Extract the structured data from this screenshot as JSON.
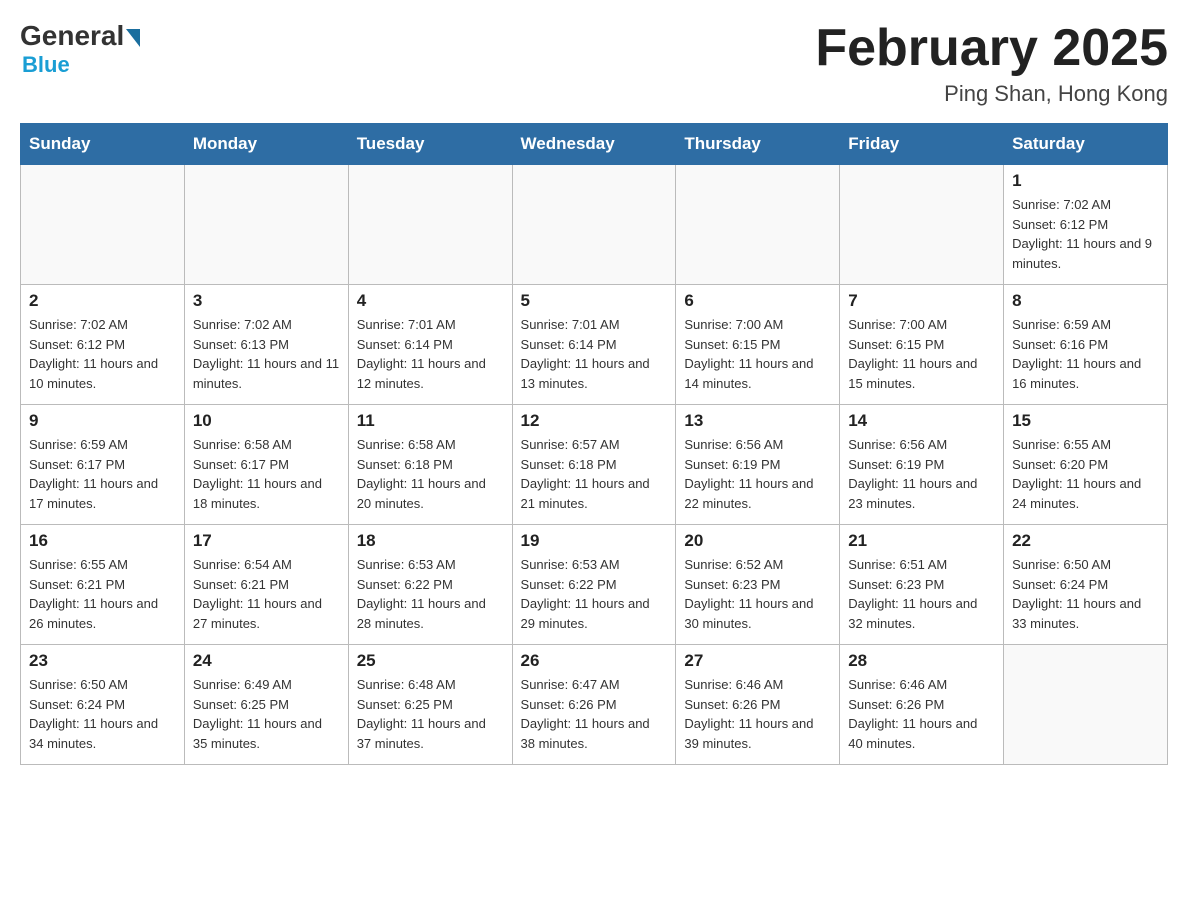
{
  "header": {
    "logo": {
      "general": "General",
      "blue": "Blue"
    },
    "title": "February 2025",
    "subtitle": "Ping Shan, Hong Kong"
  },
  "weekdays": [
    "Sunday",
    "Monday",
    "Tuesday",
    "Wednesday",
    "Thursday",
    "Friday",
    "Saturday"
  ],
  "weeks": [
    [
      {
        "day": "",
        "info": ""
      },
      {
        "day": "",
        "info": ""
      },
      {
        "day": "",
        "info": ""
      },
      {
        "day": "",
        "info": ""
      },
      {
        "day": "",
        "info": ""
      },
      {
        "day": "",
        "info": ""
      },
      {
        "day": "1",
        "info": "Sunrise: 7:02 AM\nSunset: 6:12 PM\nDaylight: 11 hours and 9 minutes."
      }
    ],
    [
      {
        "day": "2",
        "info": "Sunrise: 7:02 AM\nSunset: 6:12 PM\nDaylight: 11 hours and 10 minutes."
      },
      {
        "day": "3",
        "info": "Sunrise: 7:02 AM\nSunset: 6:13 PM\nDaylight: 11 hours and 11 minutes."
      },
      {
        "day": "4",
        "info": "Sunrise: 7:01 AM\nSunset: 6:14 PM\nDaylight: 11 hours and 12 minutes."
      },
      {
        "day": "5",
        "info": "Sunrise: 7:01 AM\nSunset: 6:14 PM\nDaylight: 11 hours and 13 minutes."
      },
      {
        "day": "6",
        "info": "Sunrise: 7:00 AM\nSunset: 6:15 PM\nDaylight: 11 hours and 14 minutes."
      },
      {
        "day": "7",
        "info": "Sunrise: 7:00 AM\nSunset: 6:15 PM\nDaylight: 11 hours and 15 minutes."
      },
      {
        "day": "8",
        "info": "Sunrise: 6:59 AM\nSunset: 6:16 PM\nDaylight: 11 hours and 16 minutes."
      }
    ],
    [
      {
        "day": "9",
        "info": "Sunrise: 6:59 AM\nSunset: 6:17 PM\nDaylight: 11 hours and 17 minutes."
      },
      {
        "day": "10",
        "info": "Sunrise: 6:58 AM\nSunset: 6:17 PM\nDaylight: 11 hours and 18 minutes."
      },
      {
        "day": "11",
        "info": "Sunrise: 6:58 AM\nSunset: 6:18 PM\nDaylight: 11 hours and 20 minutes."
      },
      {
        "day": "12",
        "info": "Sunrise: 6:57 AM\nSunset: 6:18 PM\nDaylight: 11 hours and 21 minutes."
      },
      {
        "day": "13",
        "info": "Sunrise: 6:56 AM\nSunset: 6:19 PM\nDaylight: 11 hours and 22 minutes."
      },
      {
        "day": "14",
        "info": "Sunrise: 6:56 AM\nSunset: 6:19 PM\nDaylight: 11 hours and 23 minutes."
      },
      {
        "day": "15",
        "info": "Sunrise: 6:55 AM\nSunset: 6:20 PM\nDaylight: 11 hours and 24 minutes."
      }
    ],
    [
      {
        "day": "16",
        "info": "Sunrise: 6:55 AM\nSunset: 6:21 PM\nDaylight: 11 hours and 26 minutes."
      },
      {
        "day": "17",
        "info": "Sunrise: 6:54 AM\nSunset: 6:21 PM\nDaylight: 11 hours and 27 minutes."
      },
      {
        "day": "18",
        "info": "Sunrise: 6:53 AM\nSunset: 6:22 PM\nDaylight: 11 hours and 28 minutes."
      },
      {
        "day": "19",
        "info": "Sunrise: 6:53 AM\nSunset: 6:22 PM\nDaylight: 11 hours and 29 minutes."
      },
      {
        "day": "20",
        "info": "Sunrise: 6:52 AM\nSunset: 6:23 PM\nDaylight: 11 hours and 30 minutes."
      },
      {
        "day": "21",
        "info": "Sunrise: 6:51 AM\nSunset: 6:23 PM\nDaylight: 11 hours and 32 minutes."
      },
      {
        "day": "22",
        "info": "Sunrise: 6:50 AM\nSunset: 6:24 PM\nDaylight: 11 hours and 33 minutes."
      }
    ],
    [
      {
        "day": "23",
        "info": "Sunrise: 6:50 AM\nSunset: 6:24 PM\nDaylight: 11 hours and 34 minutes."
      },
      {
        "day": "24",
        "info": "Sunrise: 6:49 AM\nSunset: 6:25 PM\nDaylight: 11 hours and 35 minutes."
      },
      {
        "day": "25",
        "info": "Sunrise: 6:48 AM\nSunset: 6:25 PM\nDaylight: 11 hours and 37 minutes."
      },
      {
        "day": "26",
        "info": "Sunrise: 6:47 AM\nSunset: 6:26 PM\nDaylight: 11 hours and 38 minutes."
      },
      {
        "day": "27",
        "info": "Sunrise: 6:46 AM\nSunset: 6:26 PM\nDaylight: 11 hours and 39 minutes."
      },
      {
        "day": "28",
        "info": "Sunrise: 6:46 AM\nSunset: 6:26 PM\nDaylight: 11 hours and 40 minutes."
      },
      {
        "day": "",
        "info": ""
      }
    ]
  ]
}
